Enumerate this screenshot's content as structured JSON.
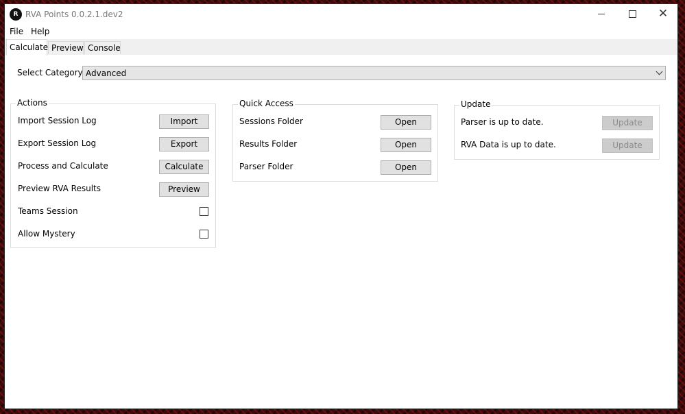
{
  "window": {
    "title": "RVA Points 0.0.2.1.dev2",
    "icon": "app-logo-icon"
  },
  "menu": {
    "items": [
      "File",
      "Help"
    ]
  },
  "tabs": [
    "Calculate",
    "Preview",
    "Console"
  ],
  "category": {
    "label": "Select Category:",
    "value": "Advanced"
  },
  "actions": {
    "title": "Actions",
    "import_label": "Import Session Log",
    "import_button": "Import",
    "export_label": "Export Session Log",
    "export_button": "Export",
    "calc_label": "Process and Calculate",
    "calc_button": "Calculate",
    "preview_label": "Preview RVA Results",
    "preview_button": "Preview",
    "teams_label": "Teams Session",
    "teams_checked": false,
    "mystery_label": "Allow Mystery",
    "mystery_checked": false
  },
  "quick_access": {
    "title": "Quick Access",
    "sessions_label": "Sessions Folder",
    "results_label": "Results Folder",
    "parser_label": "Parser Folder",
    "open_button": "Open"
  },
  "update": {
    "title": "Update",
    "parser_status": "Parser is up to date.",
    "data_status": "RVA Data is up to date.",
    "update_button": "Update"
  }
}
